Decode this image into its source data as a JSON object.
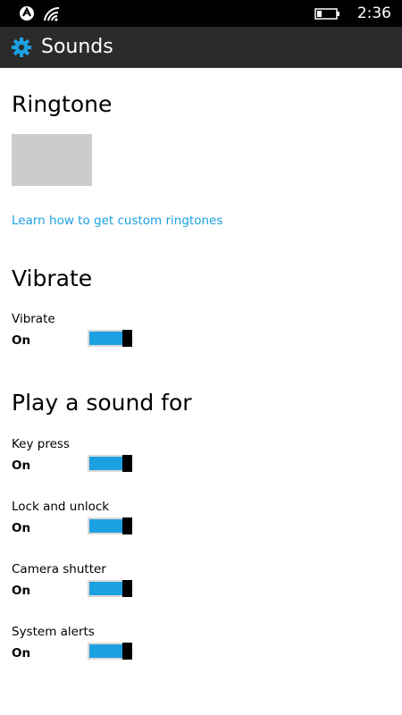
{
  "status_bar": {
    "time": "2:36",
    "icons": [
      "nfc-icon",
      "signal-icon",
      "battery-icon"
    ]
  },
  "header": {
    "title": "Sounds",
    "icon": "gear-icon",
    "accent_color": "#1ba1e2"
  },
  "ringtone": {
    "title": "Ringtone",
    "link": "Learn how to get custom ringtones"
  },
  "vibrate": {
    "title": "Vibrate",
    "label": "Vibrate",
    "state": "On"
  },
  "play_sound": {
    "title": "Play a sound for",
    "items": [
      {
        "label": "Key press",
        "state": "On"
      },
      {
        "label": "Lock and unlock",
        "state": "On"
      },
      {
        "label": "Camera shutter",
        "state": "On"
      },
      {
        "label": "System alerts",
        "state": "On"
      }
    ]
  },
  "colors": {
    "accent": "#1ba1e2",
    "header_bg": "#2b2b2b",
    "status_bar_bg": "#000000"
  }
}
